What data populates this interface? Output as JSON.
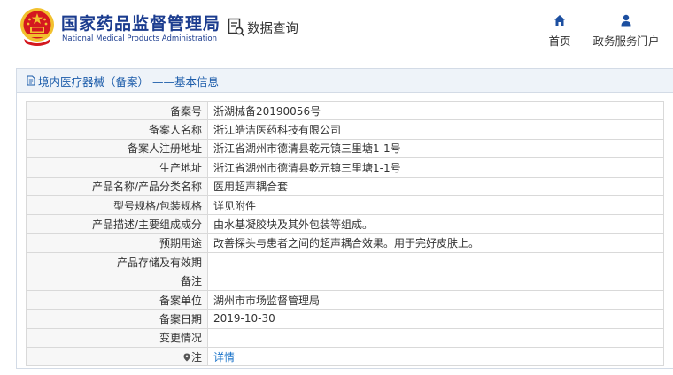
{
  "header": {
    "brand_cn": "国家药品监督管理局",
    "brand_en": "National Medical Products Administration",
    "query_label": "数据查询",
    "nav": {
      "home": "首页",
      "portal": "政务服务门户"
    }
  },
  "panel": {
    "title": "境内医疗器械（备案） ——基本信息"
  },
  "rows": [
    {
      "label": "备案号",
      "value": "浙湖械备20190056号"
    },
    {
      "label": "备案人名称",
      "value": "浙江皓洁医药科技有限公司"
    },
    {
      "label": "备案人注册地址",
      "value": "浙江省湖州市德清县乾元镇三里塘1-1号"
    },
    {
      "label": "生产地址",
      "value": "浙江省湖州市德清县乾元镇三里塘1-1号"
    },
    {
      "label": "产品名称/产品分类名称",
      "value": "医用超声耦合套"
    },
    {
      "label": "型号规格/包装规格",
      "value": "详见附件"
    },
    {
      "label": "产品描述/主要组成成分",
      "value": "由水基凝胶块及其外包装等组成。"
    },
    {
      "label": "预期用途",
      "value": "改善探头与患者之间的超声耦合效果。用于完好皮肤上。"
    },
    {
      "label": "产品存储及有效期",
      "value": ""
    },
    {
      "label": "备注",
      "value": ""
    },
    {
      "label": "备案单位",
      "value": "湖州市市场监督管理局"
    },
    {
      "label": "备案日期",
      "value": "2019-10-30"
    },
    {
      "label": "变更情况",
      "value": ""
    },
    {
      "label": "注",
      "value": "详情"
    }
  ],
  "colors": {
    "brand": "#1b3c8f",
    "link": "#1a73c9",
    "emblem_red": "#d4181f",
    "emblem_gold": "#f2c12e"
  }
}
